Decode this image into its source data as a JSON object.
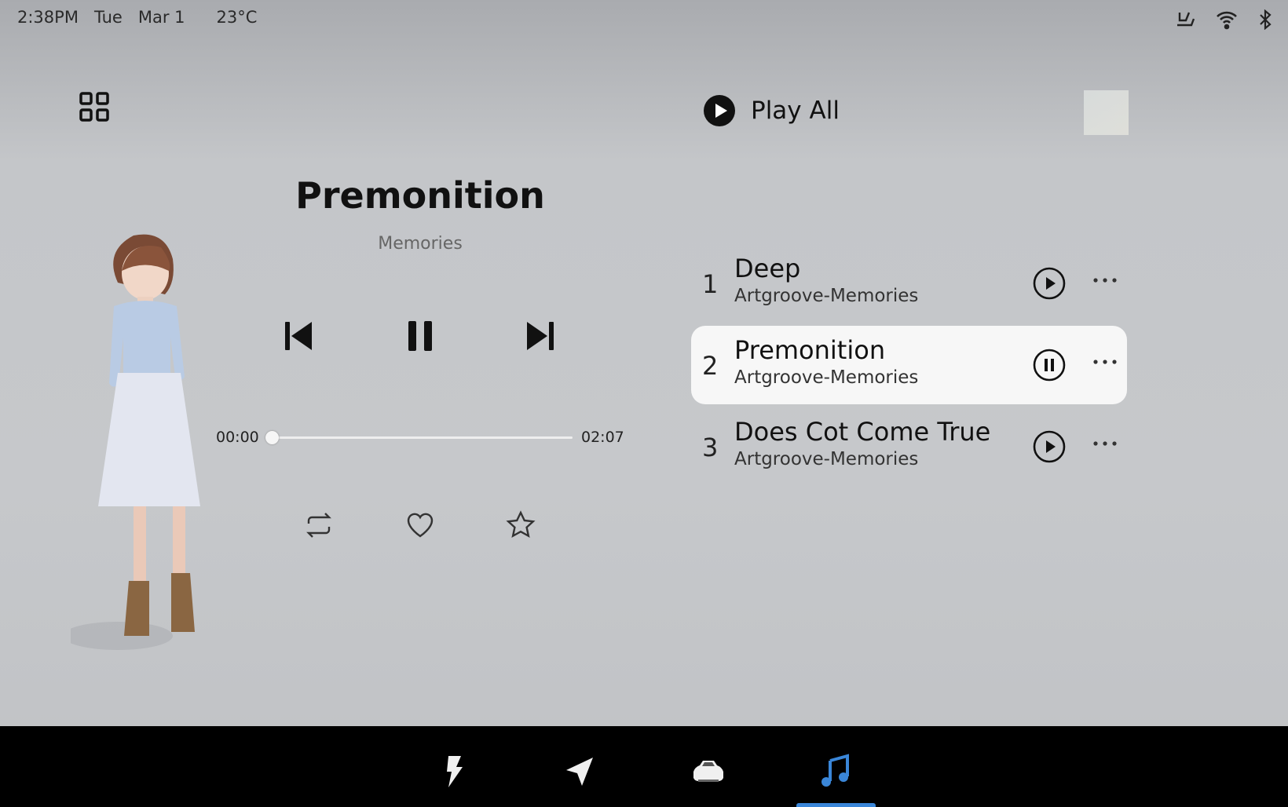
{
  "status_bar": {
    "time": "2:38PM",
    "day": "Tue",
    "date": "Mar 1",
    "temperature": "23°C",
    "icons": [
      "seat-heat-icon",
      "wifi-icon",
      "bluetooth-icon"
    ]
  },
  "now_playing": {
    "title": "Premonition",
    "album": "Memories",
    "elapsed": "00:00",
    "duration": "02:07",
    "progress": 0,
    "state": "playing"
  },
  "playlist": {
    "play_all_label": "Play All",
    "tracks": [
      {
        "number": "1",
        "title": "Deep",
        "artist": "Artgroove-Memories",
        "playing": false
      },
      {
        "number": "2",
        "title": "Premonition",
        "artist": "Artgroove-Memories",
        "playing": true
      },
      {
        "number": "3",
        "title": "Does Cot Come True",
        "artist": "Artgroove-Memories",
        "playing": false
      }
    ]
  },
  "bottom_nav": {
    "items": [
      "energy-icon",
      "navigation-icon",
      "vehicle-icon",
      "music-icon"
    ],
    "active": "music-icon",
    "accent": "#3a86d8"
  }
}
